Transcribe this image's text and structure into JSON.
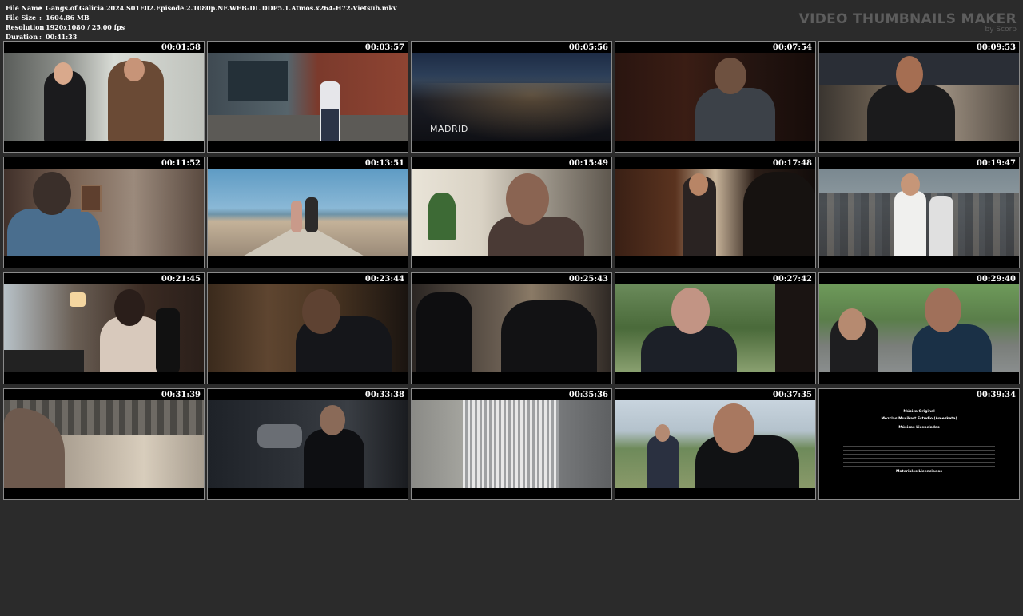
{
  "meta": {
    "file_name_label": "File Name",
    "file_name": "Gangs.of.Galicia.2024.S01E02.Episode.2.1080p.NF.WEB-DL.DDP5.1.Atmos.x264-H72-Vietsub.mkv",
    "file_size_label": "File Size",
    "file_size": "1604.86 MB",
    "resolution_label": "Resolution",
    "resolution": "1920x1080 / 25.00 fps",
    "duration_label": "Duration",
    "duration": "00:41:33",
    "separator": ":"
  },
  "watermark": {
    "title": "VIDEO THUMBNAILS MAKER",
    "byline": "by Scorp"
  },
  "thumbnails": [
    {
      "time": "00:01:58"
    },
    {
      "time": "00:03:57"
    },
    {
      "time": "00:05:56",
      "caption": "MADRID"
    },
    {
      "time": "00:07:54"
    },
    {
      "time": "00:09:53"
    },
    {
      "time": "00:11:52"
    },
    {
      "time": "00:13:51"
    },
    {
      "time": "00:15:49"
    },
    {
      "time": "00:17:48"
    },
    {
      "time": "00:19:47"
    },
    {
      "time": "00:21:45"
    },
    {
      "time": "00:23:44"
    },
    {
      "time": "00:25:43"
    },
    {
      "time": "00:27:42"
    },
    {
      "time": "00:29:40"
    },
    {
      "time": "00:31:39"
    },
    {
      "time": "00:33:38"
    },
    {
      "time": "00:35:36"
    },
    {
      "time": "00:37:35"
    },
    {
      "time": "00:39:34",
      "credits": {
        "l1": "Música Original",
        "l2": "Mezclas Musikart Estudio (Amezketa)",
        "l3": "Músicas Licenciadas",
        "l4": "Materiales Licenciados"
      }
    }
  ]
}
